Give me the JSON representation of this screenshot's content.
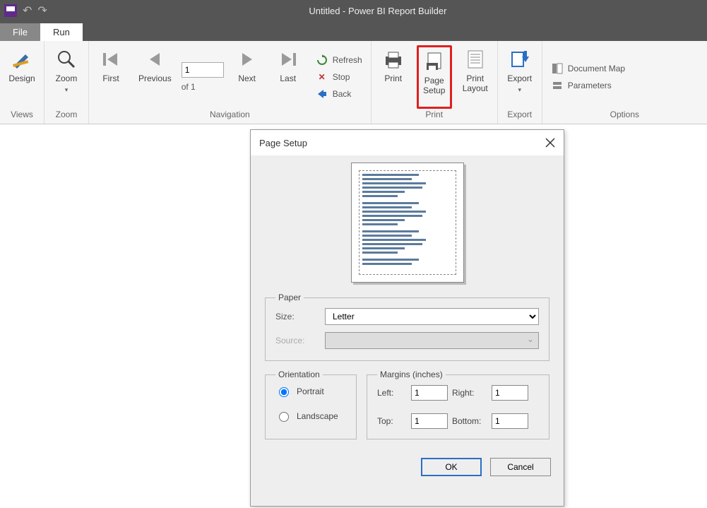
{
  "titlebar": {
    "title": "Untitled - Power BI Report Builder"
  },
  "tabs": {
    "file": "File",
    "run": "Run"
  },
  "ribbon": {
    "views": {
      "design": "Design",
      "group": "Views"
    },
    "zoom": {
      "zoom": "Zoom",
      "group": "Zoom"
    },
    "nav": {
      "first": "First",
      "previous": "Previous",
      "next": "Next",
      "last": "Last",
      "page_value": "1",
      "of_label": "of  1",
      "refresh": "Refresh",
      "stop": "Stop",
      "back": "Back",
      "group": "Navigation"
    },
    "print": {
      "print": "Print",
      "page_setup_l1": "Page",
      "page_setup_l2": "Setup",
      "print_layout_l1": "Print",
      "print_layout_l2": "Layout",
      "group": "Print"
    },
    "export": {
      "export": "Export",
      "group": "Export"
    },
    "options": {
      "docmap": "Document Map",
      "params": "Parameters",
      "group": "Options"
    }
  },
  "dialog": {
    "title": "Page Setup",
    "paper": {
      "legend": "Paper",
      "size_label": "Size:",
      "size_value": "Letter",
      "source_label": "Source:"
    },
    "orientation": {
      "legend": "Orientation",
      "portrait": "Portrait",
      "landscape": "Landscape"
    },
    "margins": {
      "legend": "Margins (inches)",
      "left_label": "Left:",
      "left_value": "1",
      "right_label": "Right:",
      "right_value": "1",
      "top_label": "Top:",
      "top_value": "1",
      "bottom_label": "Bottom:",
      "bottom_value": "1"
    },
    "ok": "OK",
    "cancel": "Cancel"
  }
}
